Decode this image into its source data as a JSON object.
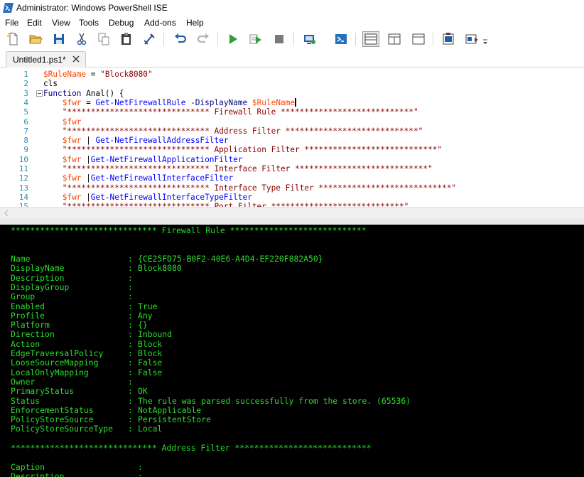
{
  "window": {
    "title": "Administrator: Windows PowerShell ISE"
  },
  "menu": [
    "File",
    "Edit",
    "View",
    "Tools",
    "Debug",
    "Add-ons",
    "Help"
  ],
  "toolbar": {
    "icons": [
      "new-icon",
      "open-icon",
      "save-icon",
      "cut-icon",
      "copy-icon",
      "paste-icon",
      "clear-icon",
      "undo-icon",
      "redo-icon",
      "run-icon",
      "run-selection-icon",
      "stop-icon",
      "new-remote-tab-icon",
      "powershell-console-icon",
      "show-script-pane-top-icon",
      "show-script-pane-right-icon",
      "show-script-pane-maximized-icon",
      "show-command-window-icon",
      "show-command-addon-icon",
      "customize-icon"
    ]
  },
  "tabs": [
    {
      "label": "Untitled1.ps1*"
    }
  ],
  "editor": {
    "line_numbers": [
      "1",
      "2",
      "3",
      "4",
      "5",
      "6",
      "7",
      "8",
      "9",
      "10",
      "11",
      "12",
      "13",
      "14",
      "15"
    ],
    "lines": [
      [
        {
          "t": "$RuleName",
          "c": "var"
        },
        {
          "t": " = ",
          "c": "plain"
        },
        {
          "t": "\"Block8080\"",
          "c": "str"
        }
      ],
      [
        {
          "t": "cls",
          "c": "fn"
        }
      ],
      [
        {
          "t": "Function",
          "c": "kw"
        },
        {
          "t": " ",
          "c": "plain"
        },
        {
          "t": "Anal",
          "c": "fn"
        },
        {
          "t": "() {",
          "c": "plain"
        }
      ],
      [
        {
          "t": "    ",
          "c": "plain"
        },
        {
          "t": "$fwr",
          "c": "var"
        },
        {
          "t": " = ",
          "c": "plain"
        },
        {
          "t": "Get-NetFirewallRule",
          "c": "cmd"
        },
        {
          "t": " ",
          "c": "plain"
        },
        {
          "t": "-DisplayName",
          "c": "param"
        },
        {
          "t": " ",
          "c": "plain"
        },
        {
          "t": "$RuleName",
          "c": "var"
        }
      ],
      [
        {
          "t": "    ",
          "c": "plain"
        },
        {
          "t": "\"****************************** Firewall Rule ****************************\"",
          "c": "str"
        }
      ],
      [
        {
          "t": "    ",
          "c": "plain"
        },
        {
          "t": "$fwr",
          "c": "var"
        }
      ],
      [
        {
          "t": "    ",
          "c": "plain"
        },
        {
          "t": "\"****************************** Address Filter ****************************\"",
          "c": "str"
        }
      ],
      [
        {
          "t": "    ",
          "c": "plain"
        },
        {
          "t": "$fwr",
          "c": "var"
        },
        {
          "t": " | ",
          "c": "plain"
        },
        {
          "t": "Get-NetFirewallAddressFilter",
          "c": "cmd"
        }
      ],
      [
        {
          "t": "    ",
          "c": "plain"
        },
        {
          "t": "\"****************************** Application Filter ****************************\"",
          "c": "str"
        }
      ],
      [
        {
          "t": "    ",
          "c": "plain"
        },
        {
          "t": "$fwr",
          "c": "var"
        },
        {
          "t": " |",
          "c": "plain"
        },
        {
          "t": "Get-NetFirewallApplicationFilter",
          "c": "cmd"
        }
      ],
      [
        {
          "t": "    ",
          "c": "plain"
        },
        {
          "t": "\"****************************** Interface Filter ****************************\"",
          "c": "str"
        }
      ],
      [
        {
          "t": "    ",
          "c": "plain"
        },
        {
          "t": "$fwr",
          "c": "var"
        },
        {
          "t": " |",
          "c": "plain"
        },
        {
          "t": "Get-NetFirewallInterfaceFilter",
          "c": "cmd"
        }
      ],
      [
        {
          "t": "    ",
          "c": "plain"
        },
        {
          "t": "\"****************************** Interface Type Filter ****************************\"",
          "c": "str"
        }
      ],
      [
        {
          "t": "    ",
          "c": "plain"
        },
        {
          "t": "$fwr",
          "c": "var"
        },
        {
          "t": " |",
          "c": "plain"
        },
        {
          "t": "Get-NetFirewallInterfaceTypeFilter",
          "c": "cmd"
        }
      ],
      [
        {
          "t": "    ",
          "c": "plain"
        },
        {
          "t": "\"****************************** Port Filter ****************************\"",
          "c": "str"
        }
      ]
    ]
  },
  "console": {
    "header1": "****************************** Firewall Rule ****************************",
    "properties": [
      {
        "name": "Name",
        "value": "{CE25FD75-B0F2-40E6-A4D4-EF220F882A50}"
      },
      {
        "name": "DisplayName",
        "value": "Block8080"
      },
      {
        "name": "Description",
        "value": ""
      },
      {
        "name": "DisplayGroup",
        "value": ""
      },
      {
        "name": "Group",
        "value": ""
      },
      {
        "name": "Enabled",
        "value": "True"
      },
      {
        "name": "Profile",
        "value": "Any"
      },
      {
        "name": "Platform",
        "value": "{}"
      },
      {
        "name": "Direction",
        "value": "Inbound"
      },
      {
        "name": "Action",
        "value": "Block"
      },
      {
        "name": "EdgeTraversalPolicy",
        "value": "Block"
      },
      {
        "name": "LooseSourceMapping",
        "value": "False"
      },
      {
        "name": "LocalOnlyMapping",
        "value": "False"
      },
      {
        "name": "Owner",
        "value": ""
      },
      {
        "name": "PrimaryStatus",
        "value": "OK"
      },
      {
        "name": "Status",
        "value": "The rule was parsed successfully from the store. (65536)"
      },
      {
        "name": "EnforcementStatus",
        "value": "NotApplicable"
      },
      {
        "name": "PolicyStoreSource",
        "value": "PersistentStore"
      },
      {
        "name": "PolicyStoreSourceType",
        "value": "Local"
      }
    ],
    "header2": "****************************** Address Filter ****************************",
    "properties2": [
      {
        "name": "Caption",
        "value": ""
      },
      {
        "name": "Description",
        "value": ""
      }
    ]
  }
}
